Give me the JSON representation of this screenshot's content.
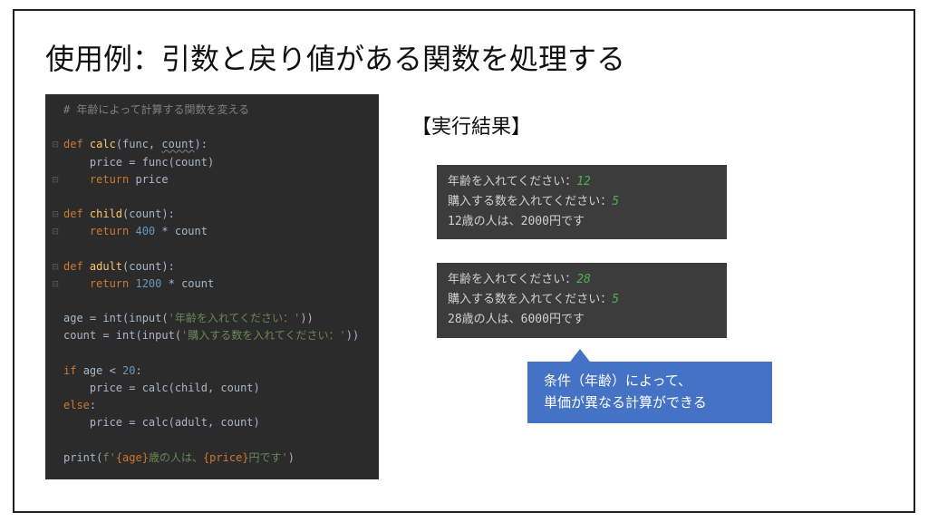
{
  "title": "使用例：引数と戻り値がある関数を処理する",
  "code": {
    "comment": "# 年齢によって計算する関数を変える",
    "l1a": "def ",
    "l1b": "calc",
    "l1c": "(func, ",
    "l1c2": "count",
    "l1d": "):",
    "l2": "    price = func(count)",
    "l3a": "    ",
    "l3b": "return ",
    "l3c": "price",
    "l4a": "def ",
    "l4b": "child",
    "l4c": "(count):",
    "l5a": "    ",
    "l5b": "return ",
    "l5c": "400",
    "l5d": " * count",
    "l6a": "def ",
    "l6b": "adult",
    "l6c": "(count):",
    "l7a": "    ",
    "l7b": "return ",
    "l7c": "1200",
    "l7d": " * count",
    "l8a": "age = int(input(",
    "l8b": "'年齢を入れてください：'",
    "l8c": "))",
    "l9a": "count = int(input(",
    "l9b": "'購入する数を入れてください：'",
    "l9c": "))",
    "l10a": "if ",
    "l10b": "age < ",
    "l10c": "20",
    "l10d": ":",
    "l11": "    price = calc(child, count)",
    "l12a": "else",
    "l12b": ":",
    "l13": "    price = calc(adult, count)",
    "l14a": "print(",
    "l14b": "f'",
    "l14c": "{age}",
    "l14d": "歳の人は、",
    "l14e": "{price}",
    "l14f": "円です'",
    "l14g": ")"
  },
  "result_heading": "【実行結果】",
  "run1": {
    "p1a": "年齢を入れてください：",
    "p1b": "12",
    "p2a": "購入する数を入れてください：",
    "p2b": "5",
    "out": "12歳の人は、2000円です"
  },
  "run2": {
    "p1a": "年齢を入れてください：",
    "p1b": "28",
    "p2a": "購入する数を入れてください：",
    "p2b": "5",
    "out": "28歳の人は、6000円です"
  },
  "callout_line1": "条件（年齢）によって、",
  "callout_line2": "単価が異なる計算ができる"
}
